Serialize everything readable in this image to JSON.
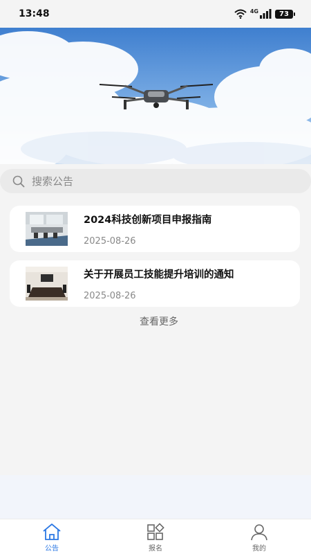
{
  "status_bar": {
    "time": "13:48",
    "network": "4G",
    "battery": "73"
  },
  "search": {
    "placeholder": "搜索公告"
  },
  "notices": [
    {
      "title": "2024科技创新项目申报指南",
      "date": "2025-08-26"
    },
    {
      "title": "关于开展员工技能提升培训的通知",
      "date": "2025-08-26"
    }
  ],
  "view_more": "查看更多",
  "tabs": [
    {
      "label": "公告",
      "icon": "home-icon",
      "active": true
    },
    {
      "label": "报名",
      "icon": "grid-icon",
      "active": false
    },
    {
      "label": "我的",
      "icon": "person-icon",
      "active": false
    }
  ],
  "colors": {
    "accent": "#2b78e4",
    "background": "#f4f4f4"
  }
}
